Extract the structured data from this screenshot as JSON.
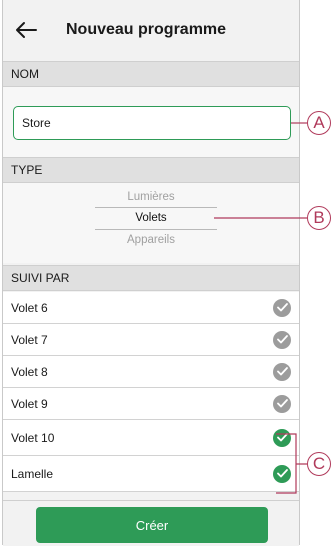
{
  "header": {
    "title": "Nouveau programme",
    "back_icon": "arrow-left-icon"
  },
  "nom": {
    "section": "NOM",
    "value": "Store"
  },
  "type": {
    "section": "TYPE",
    "options": [
      "Lumières",
      "Volets",
      "Appareils"
    ],
    "selected": "Volets"
  },
  "suivi": {
    "section": "SUIVI PAR",
    "items": [
      {
        "label": "Volet 6",
        "checked": false
      },
      {
        "label": "Volet 7",
        "checked": false
      },
      {
        "label": "Volet 8",
        "checked": false
      },
      {
        "label": "Volet 9",
        "checked": false
      },
      {
        "label": "Volet 10",
        "checked": true
      },
      {
        "label": "Lamelle",
        "checked": true
      }
    ]
  },
  "create_label": "Créer",
  "callouts": {
    "a": "A",
    "b": "B",
    "c": "C"
  },
  "colors": {
    "accent": "#2e9b57",
    "unchecked": "#9c9c9c",
    "callout": "#b03a5b"
  }
}
